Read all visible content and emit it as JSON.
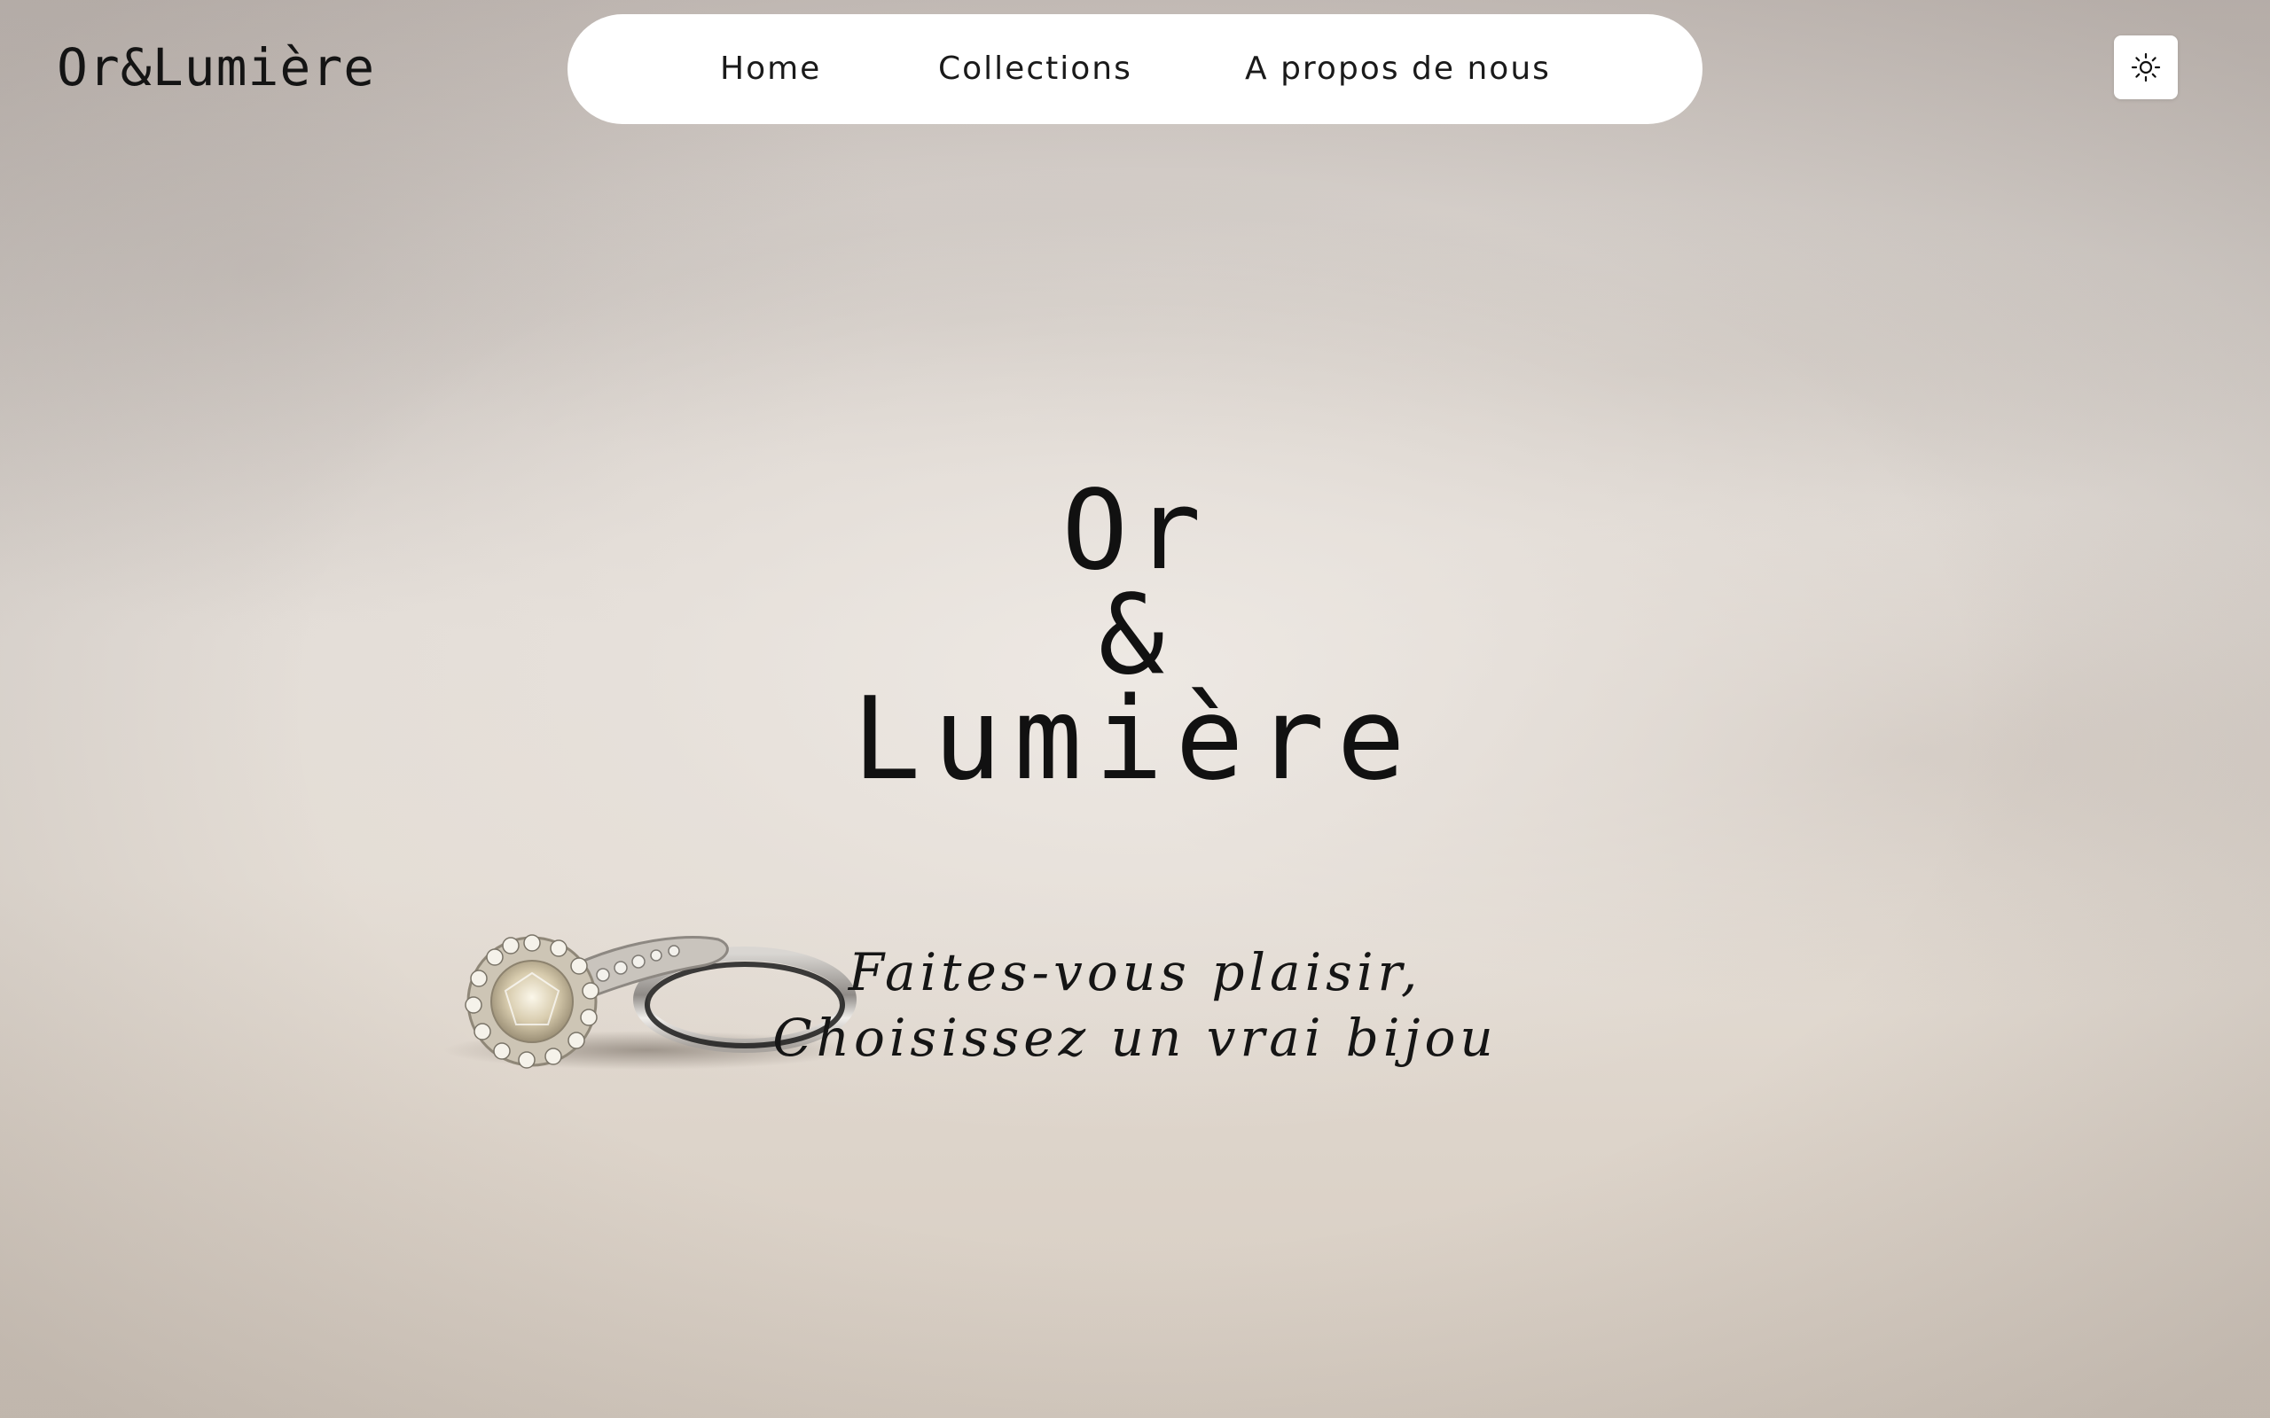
{
  "header": {
    "brand": "Or&Lumière",
    "nav": [
      {
        "label": "Home"
      },
      {
        "label": "Collections"
      },
      {
        "label": "A propos de nous"
      }
    ],
    "theme_toggle_icon": "sun-icon"
  },
  "hero": {
    "title_lines": [
      "Or",
      "&",
      "Lumière"
    ],
    "tagline_lines": [
      "Faites-vous plaisir,",
      "Choisissez un vrai bijou"
    ],
    "background_image": "rings-on-sand-photo"
  },
  "colors": {
    "text": "#111111",
    "nav_background": "#ffffff",
    "sand": "#e3ddd7"
  }
}
